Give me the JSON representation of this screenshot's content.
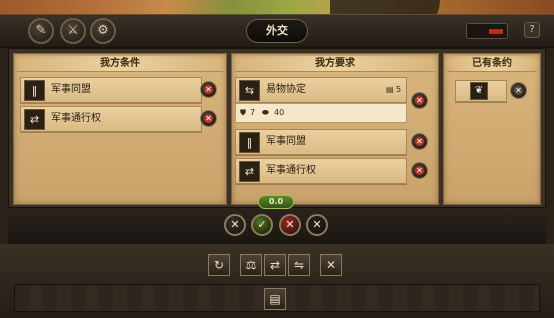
{
  "window": {
    "title": "外交"
  },
  "top_left_buttons": [
    {
      "icon": "quill-diplomacy-icon",
      "glyph": "✎"
    },
    {
      "icon": "crossed-swords-icon",
      "glyph": "⚔"
    },
    {
      "icon": "treaty-seal-icon",
      "glyph": "⚙"
    }
  ],
  "help_label": "?",
  "columns": {
    "our_offers": {
      "title": "我方条件",
      "items": [
        {
          "label": "军事同盟",
          "icon": "military-alliance-icon",
          "glyph": "‖"
        },
        {
          "label": "军事通行权",
          "icon": "military-access-icon",
          "glyph": "⇄"
        }
      ]
    },
    "our_demands": {
      "title": "我方要求",
      "trade": {
        "label": "易物协定",
        "icon": "barter-agreement-icon",
        "glyph": "⇆",
        "duration_value": "5",
        "gave_value": "7",
        "got_value": "40"
      },
      "items": [
        {
          "label": "军事同盟",
          "icon": "military-alliance-icon",
          "glyph": "‖"
        },
        {
          "label": "军事通行权",
          "icon": "military-access-icon",
          "glyph": "⇄"
        }
      ]
    },
    "existing": {
      "title": "已有条约",
      "items": [
        {
          "icon": "treaty-scroll-icon",
          "glyph": "❦"
        }
      ]
    }
  },
  "balance": {
    "value": "0.0",
    "color": "#5d8a24"
  },
  "stances": [
    {
      "icon": "war-stance-icon",
      "glyph": "✕",
      "color": "#3a3129"
    },
    {
      "icon": "peace-stance-icon",
      "glyph": "✓",
      "color": "#4f7a1e"
    },
    {
      "icon": "hostile-stance-icon",
      "glyph": "✕",
      "color": "#a12a1c"
    },
    {
      "icon": "cancel-stance-icon",
      "glyph": "✕",
      "color": "#262019"
    }
  ],
  "toolbar": [
    {
      "icon": "refresh-icon",
      "glyph": "↻"
    },
    {
      "icon": "trade-goods-icon",
      "glyph": "⚖"
    },
    {
      "icon": "exchange-icon",
      "glyph": "⇄"
    },
    {
      "icon": "swap-icon",
      "glyph": "⇋"
    },
    {
      "icon": "close-icon",
      "glyph": "✕"
    }
  ],
  "bottom_button": {
    "icon": "treaty-document-icon",
    "glyph": "▤"
  }
}
